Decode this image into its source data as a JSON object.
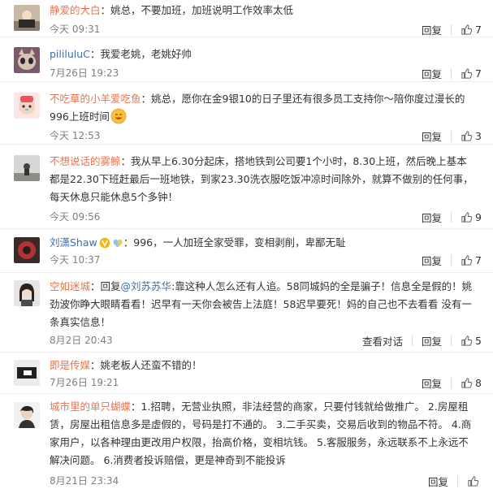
{
  "comments": [
    {
      "user": "静爱的大白",
      "sep": "：",
      "text": "姚总，不要加班，加班说明工作效率太低",
      "time": "今天 09:31",
      "reply": "回复",
      "likes": "7"
    },
    {
      "user": "pililuluC",
      "sep": "：",
      "text": "我爱老姚，老姚好帅",
      "time": "7月26日 19:23",
      "reply": "回复",
      "likes": "7"
    },
    {
      "user": "不吃草的小羊爱吃鱼",
      "sep": "：",
      "text": "姚总，愿你在金9银10的日子里还有很多员工支持你～陪你度过漫长的996上班时间",
      "time": "今天 12:53",
      "reply": "回复",
      "likes": "3"
    },
    {
      "user": "不想说话的雾鲸",
      "sep": "：",
      "text": "我从早上6.30分起床，搭地铁到公司要1个小时，8.30上班，然后晚上基本都是22.30下班赶最后一班地铁，到家23.30洗衣服吃饭冲凉时间除外，就算不做别的任何事，每天休息只能休息5个多钟！",
      "time": "今天 09:56",
      "reply": "回复",
      "likes": "9"
    },
    {
      "user": "刘潇Shaw",
      "sep": "：",
      "text": "996，一人加班全家受罪，变相剥削，卑鄙无耻",
      "time": "今天 10:37",
      "reply": "回复",
      "likes": "7"
    },
    {
      "user": "空如迷城",
      "sep": "：",
      "reply_prefix": "回复",
      "mention": "@刘苏苏华",
      "text": ":靠这种人怎么还有人追。58同城妈的全是骗子！信息全是假的！姚劲波你睁大眼睛看看！迟早有一天你会被告上法庭！58迟早要死！妈的自己也不去看看 没有一条真实信息！",
      "time": "8月2日 20:43",
      "see": "查看对话",
      "reply": "回复",
      "likes": "5"
    },
    {
      "user": "即是传媒",
      "sep": "：",
      "text": "姚老板人还蛮不错的！",
      "time": "7月26日 19:21",
      "reply": "回复",
      "likes": "8"
    },
    {
      "user": "城市里的单只蝴蝶",
      "sep": "：",
      "text": "1.招聘，无营业执照，非法经营的商家，只要付钱就给做推广。 2.房屋租赁，房屋出租信息多是虚假的，号码是打不通的。 3.二手买卖，交易后收到的物品不符。 4.商家用户，以各种理由更改用户权限，抬高价格，变相坑钱。 5.客服服务，永远联系不上永远不解决问题。 6.消费者投诉赔偿，更是神奇到不能投诉",
      "time": "8月21日 23:34",
      "reply": "回复",
      "likes": ""
    }
  ],
  "icons": {
    "like": "thumbs-up-icon",
    "emoji": "grinning-face-icon",
    "vip": "verified-v-icon",
    "heart": "heart-icon"
  },
  "colors": {
    "username_orange": "#eb7350",
    "username_blue": "#3b6eaf",
    "meta_gray": "#808080"
  }
}
